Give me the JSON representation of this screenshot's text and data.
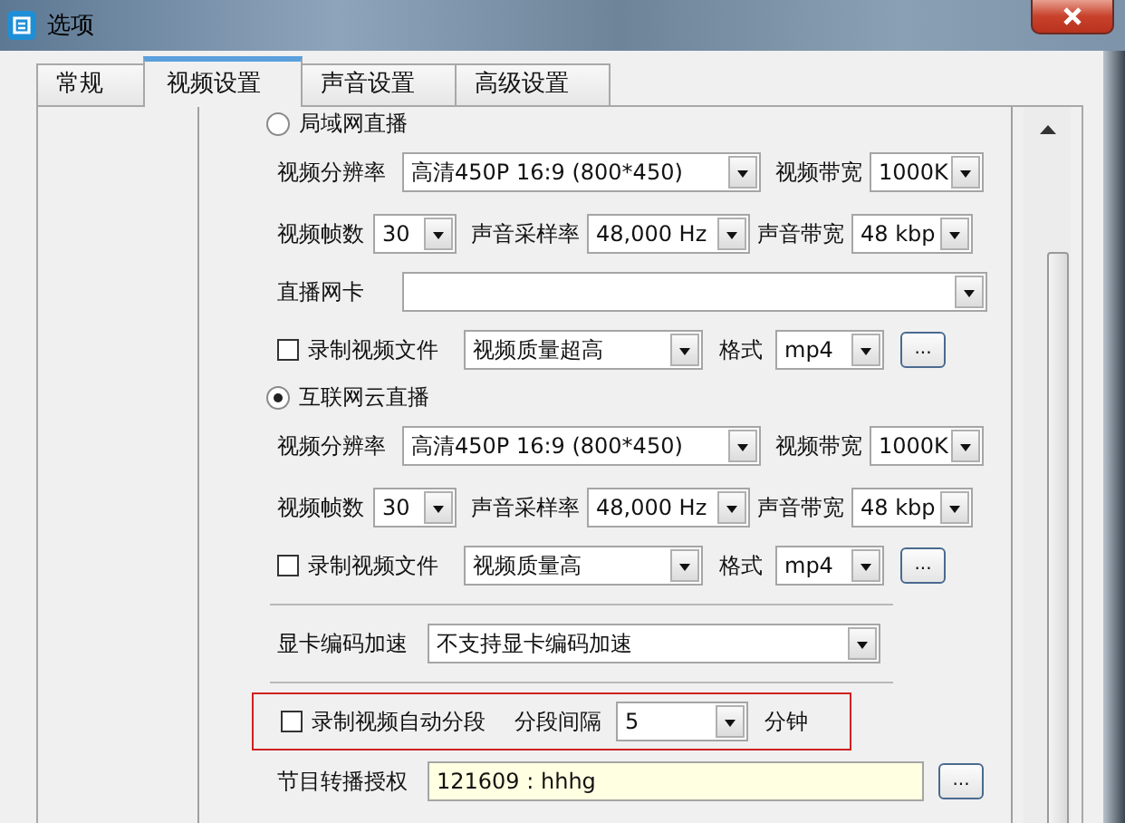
{
  "window": {
    "title": "选项"
  },
  "tabs": [
    {
      "label": "常规",
      "selected": false
    },
    {
      "label": "视频设置",
      "selected": true
    },
    {
      "label": "声音设置",
      "selected": false
    },
    {
      "label": "高级设置",
      "selected": false
    }
  ],
  "modes": [
    {
      "label": "局域网直播",
      "selected": false,
      "rows": [
        {
          "kind": "video",
          "resolution_label": "视频分辨率",
          "resolution": "高清450P 16:9 (800*450)",
          "bandwidth_label": "视频带宽",
          "bandwidth": "1000K"
        },
        {
          "kind": "audio",
          "fps_label": "视频帧数",
          "fps": "30",
          "sample_rate_label": "声音采样率",
          "sample_rate": "48,000 Hz",
          "audio_bandwidth_label": "声音带宽",
          "audio_bandwidth": "48 kbp"
        },
        {
          "kind": "nic",
          "label": "直播网卡"
        },
        {
          "kind": "record",
          "checked": false,
          "label": "录制视频文件",
          "quality": "视频质量超高",
          "format_label": "格式",
          "format": "mp4",
          "more": "..."
        }
      ]
    },
    {
      "label": "互联网云直播",
      "selected": true,
      "rows": [
        {
          "kind": "video",
          "resolution_label": "视频分辨率",
          "resolution": "高清450P 16:9 (800*450)",
          "bandwidth_label": "视频带宽",
          "bandwidth": "1000K"
        },
        {
          "kind": "audio",
          "fps_label": "视频帧数",
          "fps": "30",
          "sample_rate_label": "声音采样率",
          "sample_rate": "48,000 Hz",
          "audio_bandwidth_label": "声音带宽",
          "audio_bandwidth": "48 kbp"
        },
        {
          "kind": "record",
          "checked": false,
          "label": "录制视频文件",
          "quality": "视频质量高",
          "format_label": "格式",
          "format": "mp4",
          "more": "..."
        }
      ]
    }
  ],
  "gpu": {
    "label": "显卡编码加速",
    "value": "不支持显卡编码加速"
  },
  "segment": {
    "checked": false,
    "label": "录制视频自动分段",
    "interval_label": "分段间隔",
    "interval": "5",
    "unit": "分钟"
  },
  "auth": {
    "label": "节目转播授权",
    "value": "121609 : hhhg",
    "more": "..."
  }
}
